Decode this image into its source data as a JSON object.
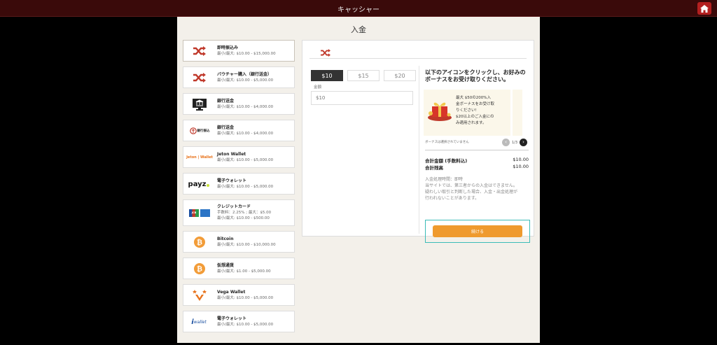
{
  "header": {
    "title": "キャッシャー"
  },
  "panel": {
    "title": "入金"
  },
  "methods": [
    {
      "name": "即時振込み",
      "range": "最小/最大: $10.00 - $15,000.00",
      "icon": "shuffle-icon"
    },
    {
      "name": "バウチャー購入（銀行送金）",
      "range": "最小/最大: $10.00 - $5,000.00",
      "icon": "shuffle-icon"
    },
    {
      "name": "銀行送金",
      "range": "最小/最大: $10.00 - $4,000.00",
      "icon": "bank-icon"
    },
    {
      "name": "銀行送金",
      "range": "最小/最大: $10.00 - $4,000.00",
      "icon": "bank-transfer-logo-icon",
      "logo_text": "銀行振込"
    },
    {
      "name": "Jeton Wallet",
      "range": "最小/最大: $10.00 - $5,000.00",
      "icon": "jeton-logo-icon",
      "logo_text": "Jeton | Wallet"
    },
    {
      "name": "電子ウォレット",
      "range": "最小/最大: $10.00 - $5,000.00",
      "icon": "payz-logo-icon",
      "logo_text": "payz"
    },
    {
      "name": "クレジットカード",
      "fee": "手数料：2.25% ; 最大：$5.00",
      "range": "最小/最大: $10.00 - $500.00",
      "icon": "credit-card-icon",
      "logo_text": "JCB"
    },
    {
      "name": "Bitcoin",
      "range": "最小/最大: $10.00 - $10,000.00",
      "icon": "bitcoin-icon"
    },
    {
      "name": "仮想通貨",
      "range": "最小/最大: $1.00 - $5,000.00",
      "icon": "bitcoin-icon"
    },
    {
      "name": "Vega Wallet",
      "range": "最小/最大: $10.00 - $5,000.00",
      "icon": "vega-logo-icon"
    },
    {
      "name": "電子ウォレット",
      "range": "最小/最大: $10.00 - $5,000.00",
      "icon": "iwallet-logo-icon",
      "logo_text": "wallet"
    }
  ],
  "amount": {
    "presets": [
      "$10",
      "$15",
      "$20"
    ],
    "selected": "$10",
    "label": "金額",
    "value": "$10"
  },
  "promo": {
    "title": "以下のアイコンをクリックし、お好みのボーナスをお受け取りください。",
    "card_lines": [
      "最大 $50の200%入",
      "金ボーナスをお受け取",
      "りください!",
      "$20以上のご入金にの",
      "み適用されます。"
    ],
    "no_bonus": "ボーナスは選択されていません",
    "pager": "1/3"
  },
  "summary": {
    "total_label": "合計金額 (手数料込)",
    "total_value": "$10.00",
    "balance_label": "合計残高",
    "balance_value": "$10.00"
  },
  "notes": [
    "入金処理時間：即時",
    "当サイトでは、第三者からの入金はできません。",
    "疑わしい取引と判断した場合、入金・出金処理が",
    "行われないことがあります。"
  ],
  "cta": {
    "label": "続ける"
  },
  "colors": {
    "accent": "#ef9a2e",
    "header": "#3a0a0a",
    "home": "#b32020",
    "highlight": "#3bbcb8",
    "selected": "#333333"
  }
}
